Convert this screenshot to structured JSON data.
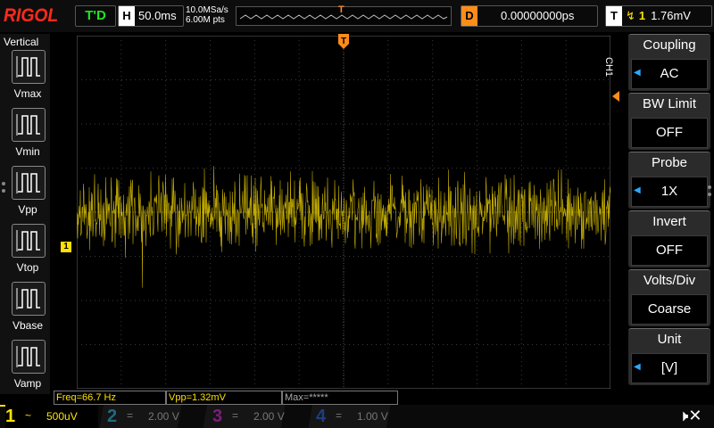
{
  "header": {
    "brand": "RIGOL",
    "run_state": "T'D",
    "timebase_tag": "H",
    "timebase": "50.0ms",
    "sample_rate": "10.0MSa/s",
    "memory_depth": "6.00M pts",
    "delay_tag": "D",
    "delay": "0.00000000ps",
    "trigger_tag": "T",
    "trigger_source": "1",
    "trigger_level": "1.76mV"
  },
  "measure_panel": {
    "title": "Vertical",
    "items": [
      {
        "label": "Vmax",
        "icon": "vmax-icon"
      },
      {
        "label": "Vmin",
        "icon": "vmin-icon"
      },
      {
        "label": "Vpp",
        "icon": "vpp-icon"
      },
      {
        "label": "Vtop",
        "icon": "vtop-icon"
      },
      {
        "label": "Vbase",
        "icon": "vbase-icon"
      },
      {
        "label": "Vamp",
        "icon": "vamp-icon"
      }
    ]
  },
  "channel_marker": "1",
  "right_menu": {
    "channel": "CH1",
    "items": [
      {
        "title": "Coupling",
        "value": "AC",
        "has_arrow": true
      },
      {
        "title": "BW Limit",
        "value": "OFF",
        "has_arrow": false
      },
      {
        "title": "Probe",
        "value": "1X",
        "has_arrow": true
      },
      {
        "title": "Invert",
        "value": "OFF",
        "has_arrow": false
      },
      {
        "title": "Volts/Div",
        "value": "Coarse",
        "has_arrow": false
      },
      {
        "title": "Unit",
        "value": "[V]",
        "has_arrow": true
      }
    ]
  },
  "measurements": {
    "freq": "Freq=66.7 Hz",
    "vpp": "Vpp=1.32mV",
    "max": "Max=*****"
  },
  "channels": [
    {
      "num": "1",
      "coupling": "~",
      "scale": "500uV",
      "color": "#ffe100"
    },
    {
      "num": "2",
      "coupling": "=",
      "scale": "2.00 V",
      "color": "#1f6b80"
    },
    {
      "num": "3",
      "coupling": "=",
      "scale": "2.00 V",
      "color": "#7a1f7a"
    },
    {
      "num": "4",
      "coupling": "=",
      "scale": "1.00 V",
      "color": "#1c3f80"
    }
  ],
  "colors": {
    "trace": "#ffe100",
    "trigger": "#ff8c1a",
    "brand": "#ff2a1c",
    "run_state": "#1fe51f"
  }
}
